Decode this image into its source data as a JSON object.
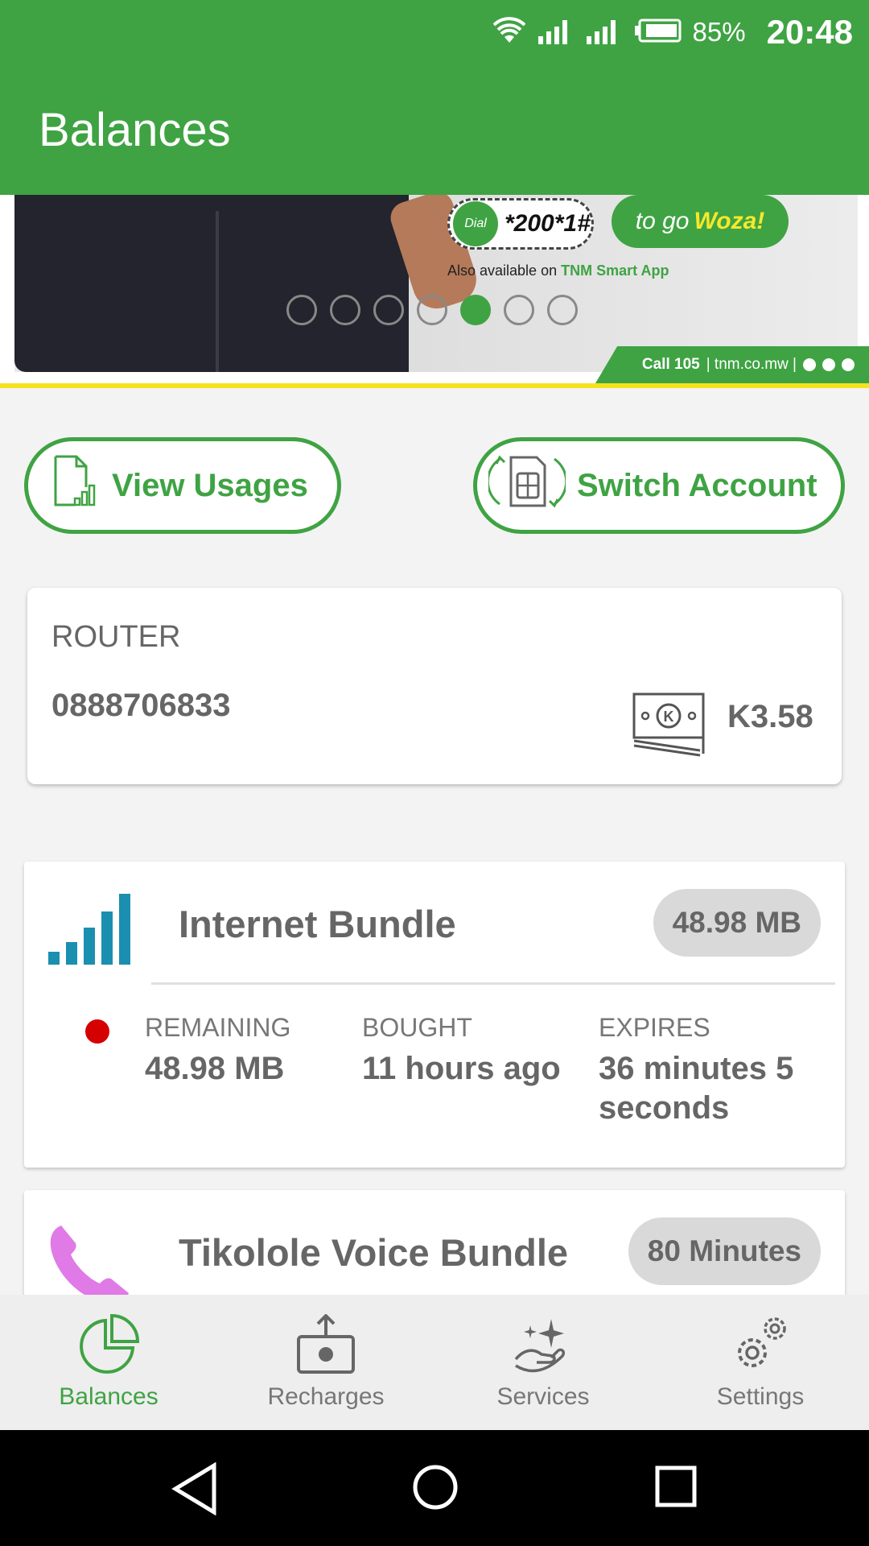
{
  "status_bar": {
    "battery_percent": "85%",
    "time": "20:48",
    "icons": [
      "wifi-icon",
      "signal-icon",
      "signal-icon",
      "battery-icon"
    ]
  },
  "app_bar": {
    "title": "Balances"
  },
  "banner": {
    "dial_label": "Dial",
    "ussd_code": "*200*1#",
    "cta_prefix": "to go",
    "cta_highlight": "Woza!",
    "also_prefix": "Also available on",
    "also_app": "TNM Smart App",
    "call_label": "Call 105",
    "site": "| tnm.co.mw |",
    "slides_total": 7,
    "active_slide": 5
  },
  "actions": {
    "view_usages": "View Usages",
    "switch_account": "Switch Account"
  },
  "account": {
    "name": "ROUTER",
    "number": "0888706833",
    "balance": "K3.58"
  },
  "bundles": [
    {
      "name": "Internet Bundle",
      "badge": "48.98 MB",
      "remaining_label": "REMAINING",
      "remaining": "48.98 MB",
      "bought_label": "BOUGHT",
      "bought": "11 hours ago",
      "expires_label": "EXPIRES",
      "expires": "36 minutes 5 seconds",
      "status_color": "#d50000"
    },
    {
      "name": "Tikolole Voice Bundle",
      "badge": "80 Minutes"
    }
  ],
  "bottom_nav": [
    {
      "label": "Balances",
      "icon": "pie-chart-icon",
      "active": true
    },
    {
      "label": "Recharges",
      "icon": "recharge-icon",
      "active": false
    },
    {
      "label": "Services",
      "icon": "services-icon",
      "active": false
    },
    {
      "label": "Settings",
      "icon": "settings-icon",
      "active": false
    }
  ],
  "colors": {
    "brand_green": "#3fa343",
    "accent_yellow": "#f5e21e",
    "badge_gray": "#d9d9d9",
    "alert_red": "#d50000"
  }
}
